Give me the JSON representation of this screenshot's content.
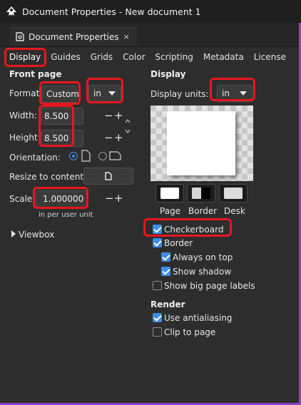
{
  "window": {
    "title": "Document Properties - New document 1",
    "dock_tab": "Document Properties",
    "dock_close": "×"
  },
  "tabs": [
    "Display",
    "Guides",
    "Grids",
    "Color",
    "Scripting",
    "Metadata",
    "License"
  ],
  "front_page": {
    "title": "Front page",
    "format_label": "Format:",
    "format_value": "Custom",
    "format_unit": "in",
    "width_label": "Width:",
    "width_value": "8.500",
    "height_label": "Height:",
    "height_value": "8.500",
    "orientation_label": "Orientation:",
    "resize_label": "Resize to content:",
    "scale_label": "Scale:",
    "scale_value": "1.000000",
    "scale_note": "in per user unit",
    "viewbox_label": "Viewbox",
    "minus": "−",
    "plus": "+"
  },
  "display": {
    "title": "Display",
    "units_label": "Display units:",
    "units_value": "in",
    "swatch_labels": [
      "Page",
      "Border",
      "Desk"
    ],
    "checkerboard": "Checkerboard",
    "border": "Border",
    "always_on_top": "Always on top",
    "show_shadow": "Show shadow",
    "big_labels": "Show big page labels"
  },
  "render": {
    "title": "Render",
    "antialiasing": "Use antialiasing",
    "clip": "Clip to page"
  },
  "colors": {
    "highlight": "#e8171f",
    "accent": "#3d8ee6",
    "window_border": "#8a45c8"
  }
}
